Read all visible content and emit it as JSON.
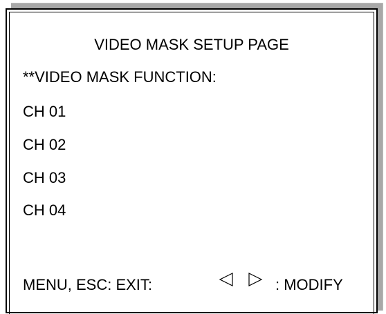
{
  "screen": {
    "title": "VIDEO MASK SETUP PAGE",
    "function_label": "**VIDEO MASK FUNCTION:",
    "channels": [
      "CH 01",
      "CH 02",
      "CH 03",
      "CH 04"
    ],
    "footer": {
      "exit_label": "MENU, ESC: EXIT:",
      "modify_label": ": MODIFY",
      "left_arrow_icon": "triangle-left-icon",
      "right_arrow_icon": "triangle-right-icon"
    }
  }
}
